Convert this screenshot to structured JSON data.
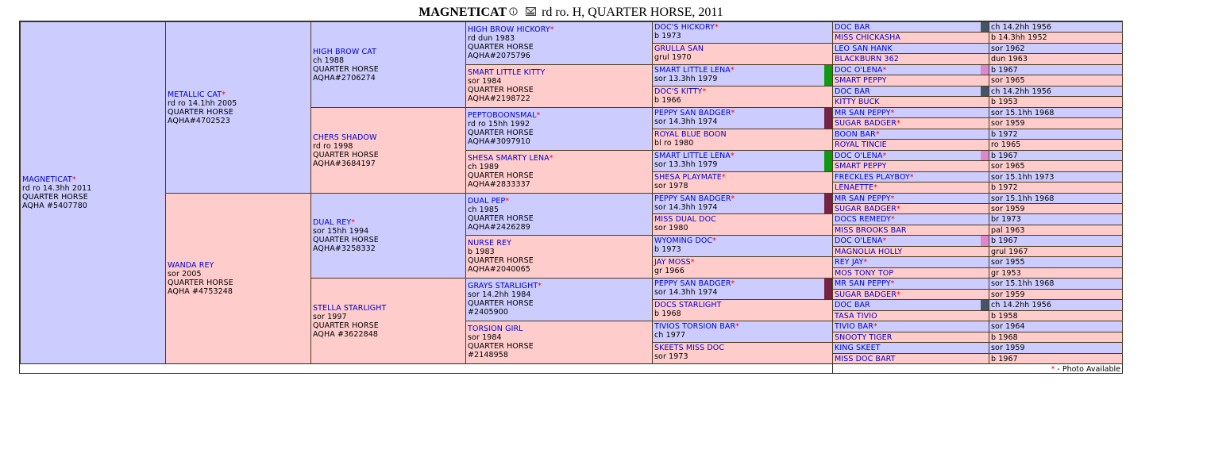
{
  "header": {
    "horse_name": "MAGNETICAT",
    "info_icon": "info-circle-icon",
    "mail_icon": "envelope-icon",
    "description": "rd ro. H, QUARTER HORSE, 2011"
  },
  "legend": {
    "star": "*",
    "text": "- Photo Available"
  },
  "colors": {
    "male_bg": "#ccccff",
    "female_bg": "#ffcccc",
    "link": "#0000cc",
    "star": "#ff0000",
    "bar_green": "#119911",
    "bar_maroon": "#772244",
    "bar_slate": "#445566",
    "bar_pink": "#dd88cc"
  },
  "g1": [
    {
      "name": "MAGNETICAT",
      "photo": true,
      "lines": [
        "rd ro 14.3hh 2011",
        "QUARTER HORSE",
        "AQHA #5407780"
      ]
    }
  ],
  "g2": [
    {
      "name": "METALLIC CAT",
      "photo": true,
      "lines": [
        "rd ro 14.1hh 2005",
        "QUARTER HORSE",
        "AQHA#4702523"
      ]
    },
    {
      "name": "WANDA REY",
      "photo": false,
      "lines": [
        "sor 2005",
        "QUARTER HORSE",
        "AQHA #4753248"
      ]
    }
  ],
  "g3": [
    {
      "name": "HIGH BROW CAT",
      "photo": false,
      "lines": [
        "ch 1988",
        "QUARTER HORSE",
        "AQHA#2706274"
      ]
    },
    {
      "name": "CHERS SHADOW",
      "photo": false,
      "lines": [
        "rd ro 1998",
        "QUARTER HORSE",
        "AQHA#3684197"
      ]
    },
    {
      "name": "DUAL REY",
      "photo": true,
      "lines": [
        "sor 15hh 1994",
        "QUARTER HORSE",
        "AQHA#3258332"
      ]
    },
    {
      "name": "STELLA STARLIGHT",
      "photo": false,
      "lines": [
        "sor 1997",
        "QUARTER HORSE",
        "AQHA #3622848"
      ]
    }
  ],
  "g4": [
    {
      "name": "HIGH BROW HICKORY",
      "photo": true,
      "lines": [
        "rd dun 1983",
        "QUARTER HORSE",
        "AQHA#2075796"
      ]
    },
    {
      "name": "SMART LITTLE KITTY",
      "photo": false,
      "lines": [
        "sor 1984",
        "QUARTER HORSE",
        "AQHA#2198722"
      ]
    },
    {
      "name": "PEPTOBOONSMAL",
      "photo": true,
      "lines": [
        "rd ro 15hh 1992",
        "QUARTER HORSE",
        "AQHA#3097910"
      ]
    },
    {
      "name": "SHESA SMARTY LENA",
      "photo": true,
      "lines": [
        "ch 1989",
        "QUARTER HORSE",
        "AQHA#2833337"
      ]
    },
    {
      "name": "DUAL PEP",
      "photo": true,
      "lines": [
        "ch 1985",
        "QUARTER HORSE",
        "AQHA#2426289"
      ]
    },
    {
      "name": "NURSE REY",
      "photo": false,
      "lines": [
        "b 1983",
        "QUARTER HORSE",
        "AQHA#2040065"
      ]
    },
    {
      "name": "GRAYS STARLIGHT",
      "photo": true,
      "lines": [
        "sor 14.2hh 1984",
        "QUARTER HORSE",
        "#2405900"
      ]
    },
    {
      "name": "TORSION GIRL",
      "photo": false,
      "lines": [
        "sor 1984",
        "QUARTER HORSE",
        "#2148958"
      ]
    }
  ],
  "g5": [
    {
      "name": "DOC'S HICKORY",
      "photo": true,
      "detail": "b 1973",
      "bar": ""
    },
    {
      "name": "GRULLA SAN",
      "photo": false,
      "detail": "grul 1970",
      "bar": ""
    },
    {
      "name": "SMART LITTLE LENA",
      "photo": true,
      "detail": "sor 13.3hh 1979",
      "bar": "green"
    },
    {
      "name": "DOC'S KITTY",
      "photo": true,
      "detail": "b 1966",
      "bar": ""
    },
    {
      "name": "PEPPY SAN BADGER",
      "photo": true,
      "detail": "sor 14.3hh 1974",
      "bar": "maroon"
    },
    {
      "name": "ROYAL BLUE BOON",
      "photo": false,
      "detail": "bl ro 1980",
      "bar": ""
    },
    {
      "name": "SMART LITTLE LENA",
      "photo": true,
      "detail": "sor 13.3hh 1979",
      "bar": "green"
    },
    {
      "name": "SHESA PLAYMATE",
      "photo": true,
      "detail": "sor 1978",
      "bar": ""
    },
    {
      "name": "PEPPY SAN BADGER",
      "photo": true,
      "detail": "sor 14.3hh 1974",
      "bar": "maroon"
    },
    {
      "name": "MISS DUAL DOC",
      "photo": false,
      "detail": "sor 1980",
      "bar": ""
    },
    {
      "name": "WYOMING DOC",
      "photo": true,
      "detail": "b 1973",
      "bar": ""
    },
    {
      "name": "JAY MOSS",
      "photo": true,
      "detail": "gr 1966",
      "bar": ""
    },
    {
      "name": "PEPPY SAN BADGER",
      "photo": true,
      "detail": "sor 14.3hh 1974",
      "bar": "maroon"
    },
    {
      "name": "DOCS STARLIGHT",
      "photo": false,
      "detail": "b 1968",
      "bar": ""
    },
    {
      "name": "TIVIOS TORSION BAR",
      "photo": true,
      "detail": "ch 1977",
      "bar": ""
    },
    {
      "name": "SKEETS MISS DOC",
      "photo": false,
      "detail": "sor 1973",
      "bar": ""
    }
  ],
  "g6": [
    {
      "name": "DOC BAR",
      "photo": false,
      "detail": "ch 14.2hh 1956",
      "bar": "slate"
    },
    {
      "name": "MISS CHICKASHA",
      "photo": false,
      "detail": "b 14.3hh 1952",
      "bar": ""
    },
    {
      "name": "LEO SAN HANK",
      "photo": false,
      "detail": "sor 1962",
      "bar": ""
    },
    {
      "name": "BLACKBURN 362",
      "photo": false,
      "detail": "dun 1963",
      "bar": ""
    },
    {
      "name": "DOC O'LENA",
      "photo": true,
      "detail": "b 1967",
      "bar": "pink"
    },
    {
      "name": "SMART PEPPY",
      "photo": false,
      "detail": "sor 1965",
      "bar": ""
    },
    {
      "name": "DOC BAR",
      "photo": false,
      "detail": "ch 14.2hh 1956",
      "bar": "slate"
    },
    {
      "name": "KITTY BUCK",
      "photo": false,
      "detail": "b 1953",
      "bar": ""
    },
    {
      "name": "MR SAN PEPPY",
      "photo": true,
      "detail": "sor 15.1hh 1968",
      "bar": ""
    },
    {
      "name": "SUGAR BADGER",
      "photo": true,
      "detail": "sor 1959",
      "bar": ""
    },
    {
      "name": "BOON BAR",
      "photo": true,
      "detail": "b 1972",
      "bar": ""
    },
    {
      "name": "ROYAL TINCIE",
      "photo": false,
      "detail": "ro 1965",
      "bar": ""
    },
    {
      "name": "DOC O'LENA",
      "photo": true,
      "detail": "b 1967",
      "bar": "pink"
    },
    {
      "name": "SMART PEPPY",
      "photo": false,
      "detail": "sor 1965",
      "bar": ""
    },
    {
      "name": "FRECKLES PLAYBOY",
      "photo": true,
      "detail": "sor 15.1hh 1973",
      "bar": ""
    },
    {
      "name": "LENAETTE",
      "photo": true,
      "detail": "b 1972",
      "bar": ""
    },
    {
      "name": "MR SAN PEPPY",
      "photo": true,
      "detail": "sor 15.1hh 1968",
      "bar": ""
    },
    {
      "name": "SUGAR BADGER",
      "photo": true,
      "detail": "sor 1959",
      "bar": ""
    },
    {
      "name": "DOCS REMEDY",
      "photo": true,
      "detail": "br 1973",
      "bar": ""
    },
    {
      "name": "MISS BROOKS BAR",
      "photo": false,
      "detail": "pal 1963",
      "bar": ""
    },
    {
      "name": "DOC O'LENA",
      "photo": true,
      "detail": "b 1967",
      "bar": "pink"
    },
    {
      "name": "MAGNOLIA HOLLY",
      "photo": false,
      "detail": "grul 1967",
      "bar": ""
    },
    {
      "name": "REY JAY",
      "photo": true,
      "detail": "sor 1955",
      "bar": ""
    },
    {
      "name": "MOS TONY TOP",
      "photo": false,
      "detail": "gr 1953",
      "bar": ""
    },
    {
      "name": "MR SAN PEPPY",
      "photo": true,
      "detail": "sor 15.1hh 1968",
      "bar": ""
    },
    {
      "name": "SUGAR BADGER",
      "photo": true,
      "detail": "sor 1959",
      "bar": ""
    },
    {
      "name": "DOC BAR",
      "photo": false,
      "detail": "ch 14.2hh 1956",
      "bar": "slate"
    },
    {
      "name": "TASA TIVIO",
      "photo": false,
      "detail": "b 1958",
      "bar": ""
    },
    {
      "name": "TIVIO BAR",
      "photo": true,
      "detail": "sor 1964",
      "bar": ""
    },
    {
      "name": "SNOOTY TIGER",
      "photo": false,
      "detail": "b 1968",
      "bar": ""
    },
    {
      "name": "KING SKEET",
      "photo": false,
      "detail": "sor 1959",
      "bar": ""
    },
    {
      "name": "MISS DOC BART",
      "photo": false,
      "detail": "b 1967",
      "bar": ""
    }
  ]
}
